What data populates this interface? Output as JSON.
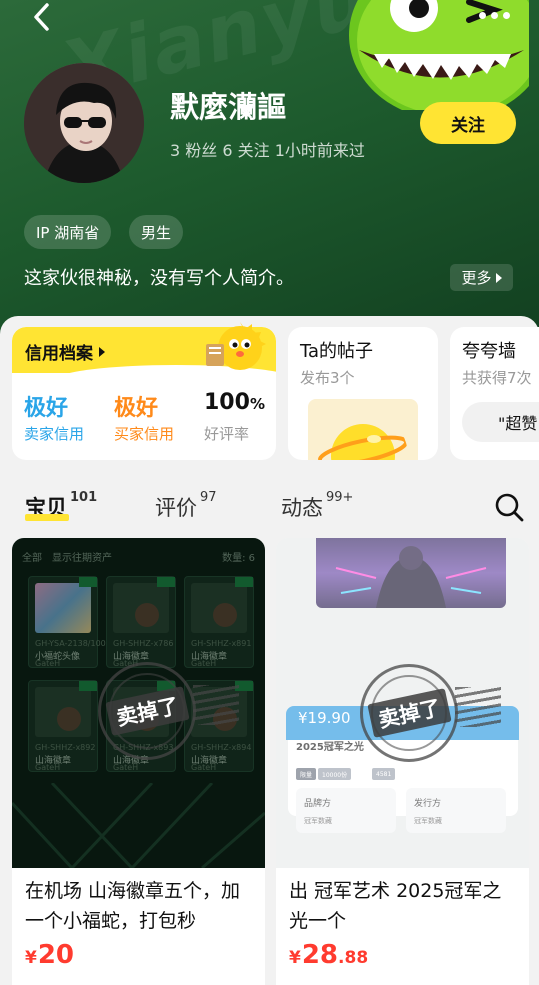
{
  "profile": {
    "username": "默麼灡謳",
    "stats": "3 粉丝   6 关注   1小时前来过",
    "follow_label": "关注",
    "tags": [
      "IP 湖南省",
      "男生"
    ],
    "bio": "这家伙很神秘，没有写个人简介。",
    "bio_more_label": "更多"
  },
  "credit": {
    "title": "信用档案",
    "seller_value": "极好",
    "seller_label": "卖家信用",
    "buyer_value": "极好",
    "buyer_label": "买家信用",
    "rate_value": "100",
    "rate_unit": "%",
    "rate_label": "好评率"
  },
  "posts": {
    "title": "Ta的帖子",
    "sub": "发布3个"
  },
  "praise": {
    "title": "夸夸墙",
    "sub": "共获得7次",
    "chip": "\"超赞"
  },
  "tabs": [
    {
      "label": "宝贝",
      "count": "101"
    },
    {
      "label": "评价",
      "count": "97"
    },
    {
      "label": "动态",
      "count": "99+"
    }
  ],
  "products": [
    {
      "title": "在机场 山海徽章五个，加一个小福蛇，打包秒",
      "price_symbol": "¥",
      "price_main": "20",
      "price_decimal": "",
      "sold_label": "卖掉了",
      "image": {
        "filter_all": "全部",
        "filter_history": "显示往期资产",
        "count_label": "数量: 6",
        "tiles": [
          {
            "code": "GH-YSA-2138/10000",
            "name": "小福蛇头像",
            "sub": "GateH"
          },
          {
            "code": "GH-SHHZ-x786",
            "name": "山海徽章",
            "sub": "GateH"
          },
          {
            "code": "GH-SHHZ-x891",
            "name": "山海徽章",
            "sub": "GateH"
          },
          {
            "code": "GH-SHHZ-x892",
            "name": "山海徽章",
            "sub": "GateH"
          },
          {
            "code": "GH-SHHZ-x893",
            "name": "山海徽章",
            "sub": "GateH"
          },
          {
            "code": "GH-SHHZ-x894",
            "name": "山海徽章",
            "sub": "GateH"
          }
        ]
      }
    },
    {
      "title": "出 冠军艺术 2025冠军之光一个",
      "price_symbol": "¥",
      "price_main": "28",
      "price_decimal": ".88",
      "sold_label": "卖掉了",
      "image": {
        "price": "¥19.90",
        "name": "2025冠军之光",
        "chip_limited": "限量",
        "chip_count": "10000份",
        "chip_sold": "4581",
        "brand_label": "品牌方",
        "brand_value": "冠军数藏",
        "publisher_label": "发行方",
        "publisher_value": "冠军数藏"
      }
    }
  ],
  "colors": {
    "accent": "#ffe433",
    "price": "#ff3b2f",
    "seller": "#2aa5e8",
    "buyer": "#ff8a1a",
    "hero": "#1d5a2d"
  },
  "icons": [
    "back-arrow-icon",
    "more-dots-icon",
    "search-icon",
    "triangle-right-icon"
  ]
}
